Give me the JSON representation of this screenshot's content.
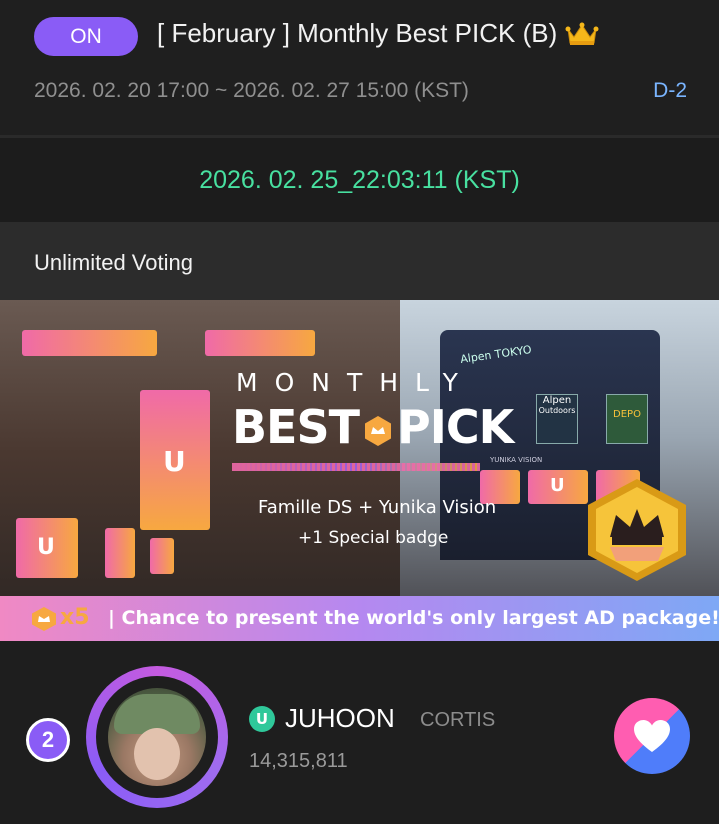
{
  "header": {
    "status_badge": "ON",
    "title": "[ February ] Monthly Best PICK (B)",
    "title_icon": "crown-icon",
    "period": "2026. 02. 20 17:00 ~ 2026. 02. 27 15:00 (KST)",
    "dday": "D-2"
  },
  "current_time": "2026. 02. 25_22:03:11 (KST)",
  "section": {
    "title": "Unlimited Voting"
  },
  "banner": {
    "monthly": "MONTHLY",
    "best_left": "BEST",
    "best_right": "PICK",
    "package_line1": "Famille DS + Yunika Vision",
    "package_line2": "+1 Special badge",
    "multiplier": "x5",
    "bottom_text": "| Chance to present the world's only largest AD package!",
    "signs": {
      "alpen_tokyo": "Alpen TOKYO",
      "alpen": "Alpen",
      "outdoors": "Outdoors",
      "depo": "DEPO",
      "yunika_vision": "YUNIKA VISION"
    }
  },
  "ranking": {
    "rank": "2",
    "artist": "JUHOON",
    "group": "CORTIS",
    "votes": "14,315,811"
  },
  "colors": {
    "accent_purple": "#8a5cf6",
    "time_green": "#48e0a0",
    "dday_blue": "#7ab5ff",
    "heart_pink": "#ff5db1",
    "heart_blue": "#4f7dfa"
  }
}
